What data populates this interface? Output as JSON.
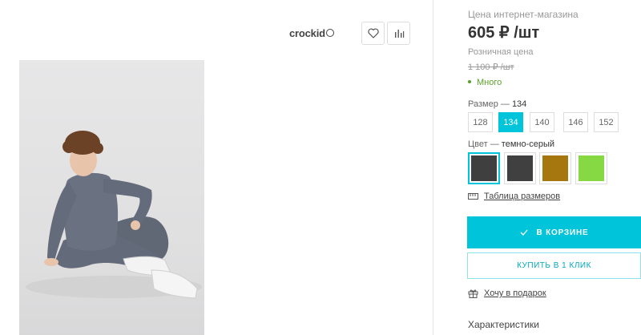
{
  "gallery": {
    "brand": "crockid",
    "favorite_icon": "heart-icon",
    "compare_icon": "bar-chart-icon",
    "photo_alt": "Мальчик в комплекте темно-серого цвета"
  },
  "product": {
    "price_label": "Цена интернет-магазина",
    "price": "605 ₽ /шт",
    "retail_label": "Розничная цена",
    "retail_price": "1 100 ₽ /шт",
    "stock": "Много",
    "stock_color": "#5aa02c"
  },
  "size": {
    "label": "Размер",
    "selected": "134",
    "options": [
      "128",
      "134",
      "140",
      "146",
      "152"
    ]
  },
  "color": {
    "label": "Цвет",
    "selected": "темно-серый",
    "swatches": [
      "#3f3f3f",
      "#404040",
      "#a6770f",
      "#86d943"
    ]
  },
  "actions": {
    "size_chart": "Таблица размеров",
    "in_cart": "В КОРЗИНЕ",
    "buy_one_click": "КУПИТЬ В 1 КЛИК",
    "gift": "Хочу в подарок",
    "accent_color": "#00c4d9"
  },
  "characteristics_title": "Характеристики"
}
